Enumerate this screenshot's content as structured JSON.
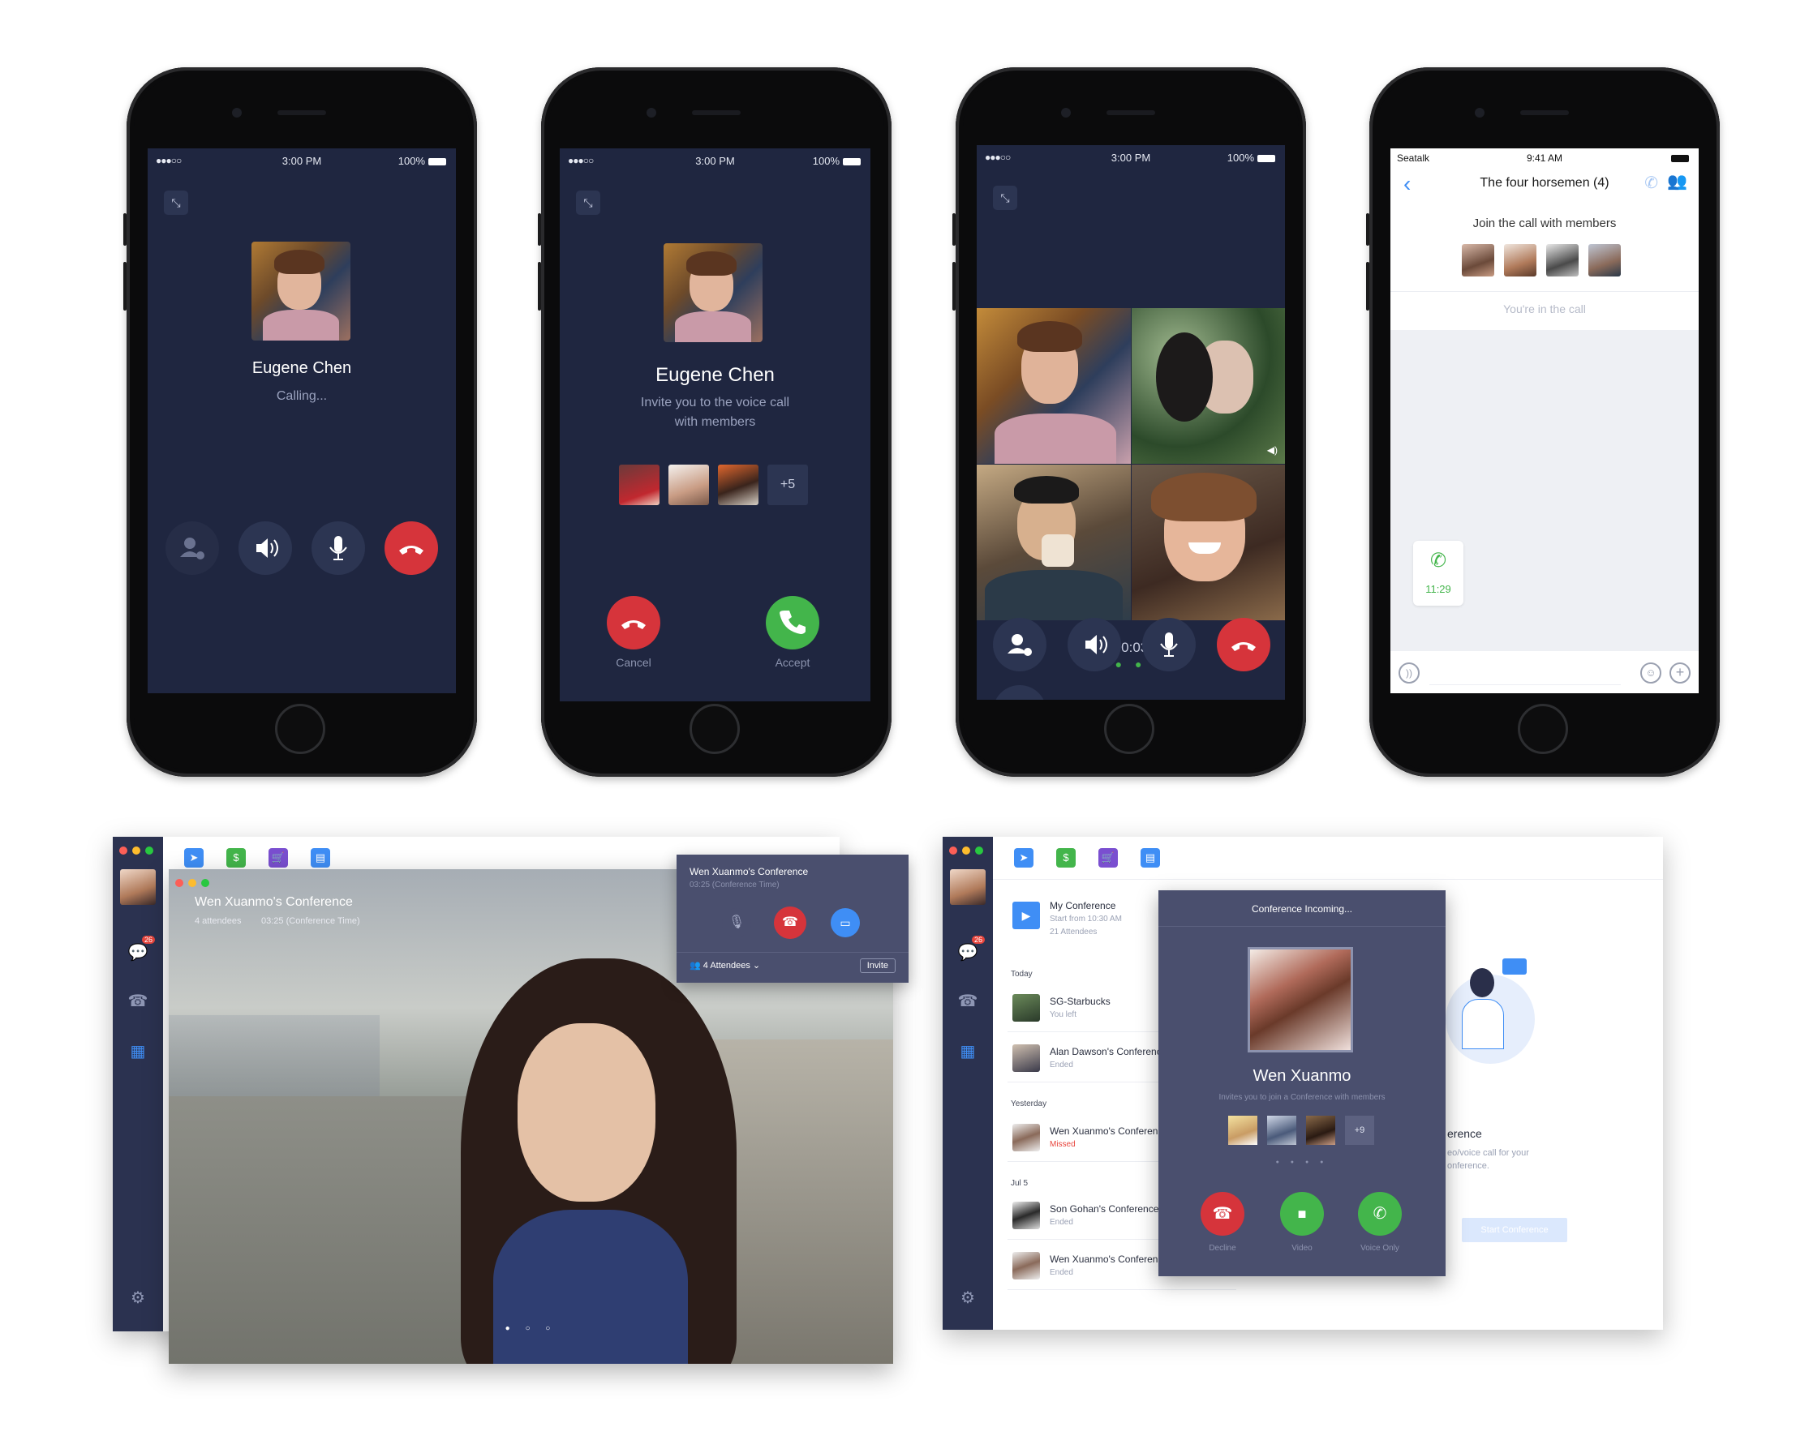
{
  "status_bar": {
    "dots": "●●●○○",
    "time": "3:00 PM",
    "battery": "100%"
  },
  "phone1": {
    "name": "Eugene Chen",
    "status": "Calling..."
  },
  "phone2": {
    "name": "Eugene Chen",
    "line1": "Invite you to the voice call",
    "line2": "with members",
    "more_count": "+5",
    "cancel_label": "Cancel",
    "accept_label": "Accept"
  },
  "phone3": {
    "timer": "00:03",
    "dots": "● ● ● ●"
  },
  "phone4": {
    "carrier": "Seatalk",
    "time": "9:41 AM",
    "title": "The four horsemen (4)",
    "join_text": "Join the call with members",
    "in_call_text": "You're in the call",
    "bubble_time": "11:29"
  },
  "desk1": {
    "title": "Wen Xuanmo's Conference",
    "attendees": "4 attendees",
    "duration": "03:25 (Conference Time)",
    "badge": "26",
    "popup_title": "Wen Xuanmo's Conference",
    "popup_time": "03:25 (Conference Time)",
    "popup_attendees": "4 Attendees",
    "invite_label": "Invite"
  },
  "desk2": {
    "badge": "26",
    "my_conf_title": "My Conference",
    "my_conf_time": "Start from 10:30 AM",
    "my_conf_count": "21 Attendees",
    "section_today": "Today",
    "section_yesterday": "Yesterday",
    "section_jul": "Jul 5",
    "rows": [
      {
        "title": "SG-Starbucks",
        "status": "You left"
      },
      {
        "title": "Alan Dawson's Conference",
        "status": "Ended"
      },
      {
        "title": "Wen Xuanmo's Conference",
        "status": "Missed"
      },
      {
        "title": "Son Gohan's Conference",
        "status": "Ended"
      },
      {
        "title": "Wen Xuanmo's Conference",
        "status": "Ended"
      }
    ],
    "right_title_partial": "erence",
    "right_text1": "eo/voice call for your",
    "right_text2": "onference.",
    "start_label": "Start Conference",
    "incoming_title": "Conference Incoming...",
    "caller": "Wen Xuanmo",
    "invite_text": "Invites you to join a Conference with members",
    "more_count": "+9",
    "decline_label": "Decline",
    "video_label": "Video",
    "voice_label": "Voice Only"
  },
  "colors": {
    "call_bg": "#1f2640",
    "red": "#d6343b",
    "green": "#43b54b",
    "sidebar": "#2b3250",
    "accent": "#3f8ef5"
  }
}
